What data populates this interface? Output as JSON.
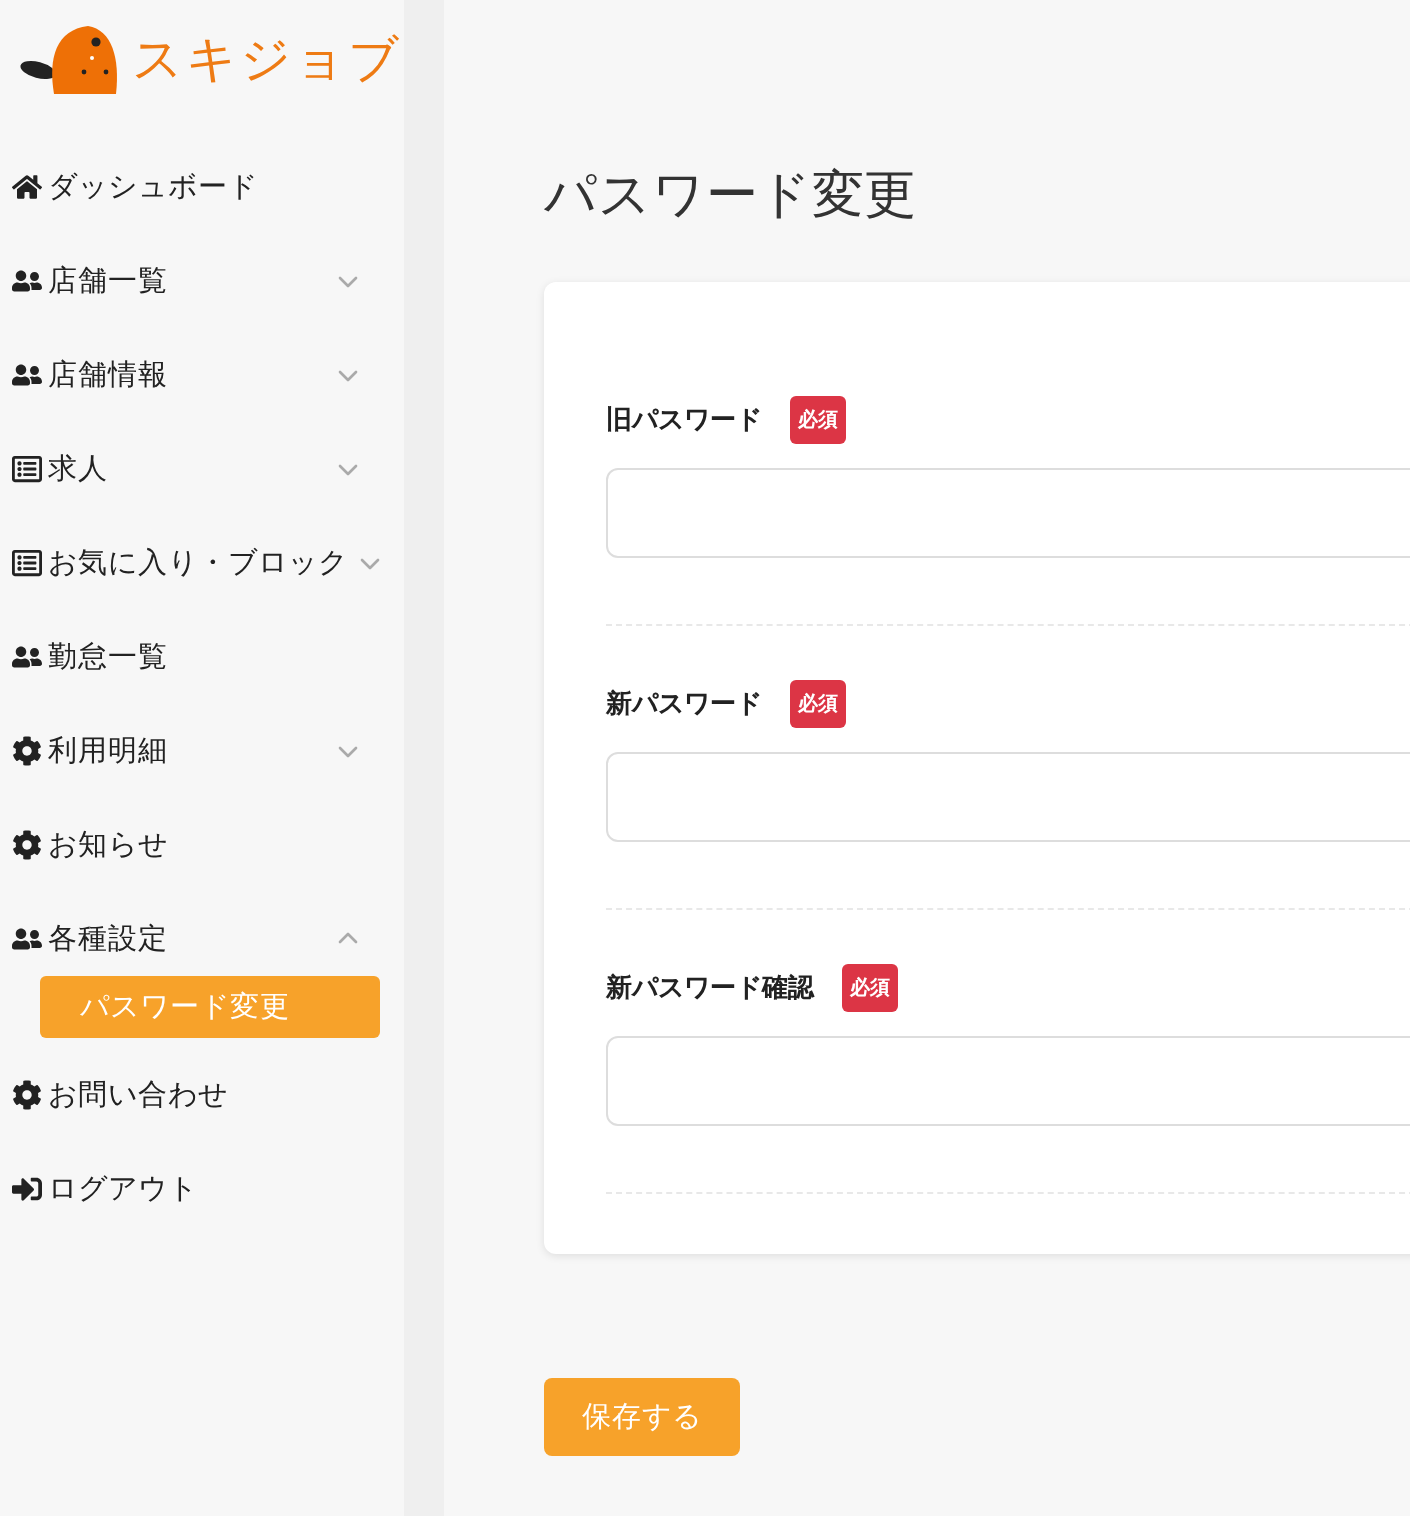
{
  "logo": {
    "text": "スキジョブ"
  },
  "sidebar": {
    "items": [
      {
        "label": "ダッシュボード",
        "kind": "home"
      },
      {
        "label": "店舗一覧",
        "kind": "users",
        "expanded": false
      },
      {
        "label": "店舗情報",
        "kind": "users",
        "expanded": false
      },
      {
        "label": "求人",
        "kind": "list",
        "expanded": false
      },
      {
        "label": "お気に入り・ブロック",
        "kind": "list",
        "expanded": false
      },
      {
        "label": "勤怠一覧",
        "kind": "users"
      },
      {
        "label": "利用明細",
        "kind": "gear",
        "expanded": false
      },
      {
        "label": "お知らせ",
        "kind": "gear"
      },
      {
        "label": "各種設定",
        "kind": "users",
        "expanded": true,
        "children": [
          {
            "label": "パスワード変更",
            "selected": true
          }
        ]
      },
      {
        "label": "お問い合わせ",
        "kind": "gear"
      },
      {
        "label": "ログアウト",
        "kind": "logout"
      }
    ]
  },
  "page": {
    "title": "パスワード変更"
  },
  "form": {
    "fields": [
      {
        "label": "旧パスワード",
        "badge": "必須"
      },
      {
        "label": "新パスワード",
        "badge": "必須"
      },
      {
        "label": "新パスワード確認",
        "badge": "必須"
      }
    ]
  },
  "save_button": "保存する"
}
